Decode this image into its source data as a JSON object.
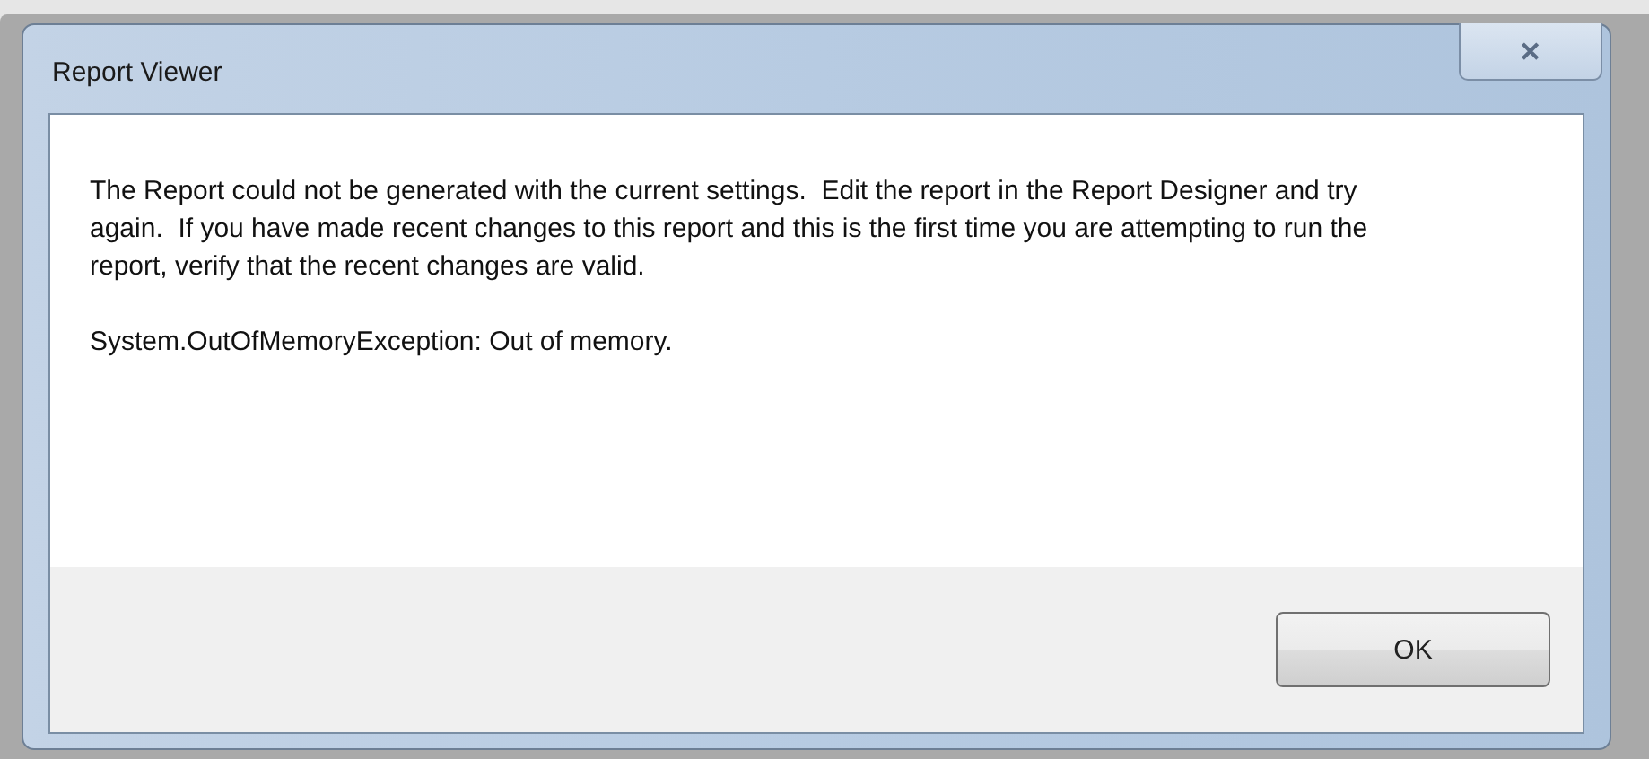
{
  "window": {
    "title": "Report Viewer",
    "close_glyph": "✕"
  },
  "message": {
    "text": "The Report could not be generated with the current settings.  Edit the report in the Report Designer and try again.  If you have made recent changes to this report and this is the first time you are attempting to run the report, verify that the recent changes are valid.",
    "error": "System.OutOfMemoryException: Out of memory."
  },
  "buttons": [
    "OK"
  ]
}
